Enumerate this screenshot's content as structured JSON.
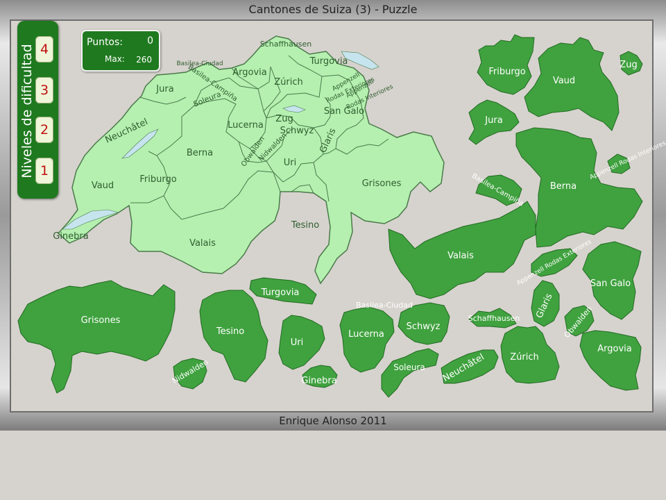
{
  "window": {
    "title": "Cantones de Suiza (3) - Puzzle",
    "footer": "Enrique Alonso 2011"
  },
  "levels": {
    "title": "Niveles de dificultad",
    "buttons": [
      "4",
      "3",
      "2",
      "1"
    ]
  },
  "score": {
    "points_label": "Puntos:",
    "points": "0",
    "max_label": "Max:",
    "max": "260"
  },
  "board": {
    "colors": {
      "board_fill": "#b5f0b0",
      "board_stroke": "#4a7a4a",
      "lake": "#c6e4ee"
    },
    "labels": [
      "Schaffhausen",
      "Basilea-Ciudad",
      "Turgovia",
      "Argovia",
      "Basilea-Campiña",
      "Zúrich",
      "Jura",
      "Soleura",
      "Appenzell",
      "Rodas Exteriores",
      "Appenzell",
      "Rodas Interiores",
      "San Galo",
      "Neuchâtel",
      "Lucerna",
      "Zug",
      "Schwyz",
      "Glaris",
      "Berna",
      "Obwalden",
      "Nidwalden",
      "Uri",
      "Friburgo",
      "Vaud",
      "Grisones",
      "Tesino",
      "Valais",
      "Ginebra"
    ]
  },
  "pieces": [
    "Friburgo",
    "Vaud",
    "Zug",
    "Jura",
    "Berna",
    "Appenzell Rodas Interiores",
    "Basilea-Campiña",
    "Valais",
    "Appenzell Rodas Exteriores",
    "San Galo",
    "Grisones",
    "Turgovia",
    "Tesino",
    "Uri",
    "Basilea-Ciudad",
    "Lucerna",
    "Schwyz",
    "Schaffhausen",
    "Glaris",
    "Obwalden",
    "Argovia",
    "Zúrich",
    "Neuchâtel",
    "Soleura",
    "Nidwalden",
    "Ginebra"
  ]
}
